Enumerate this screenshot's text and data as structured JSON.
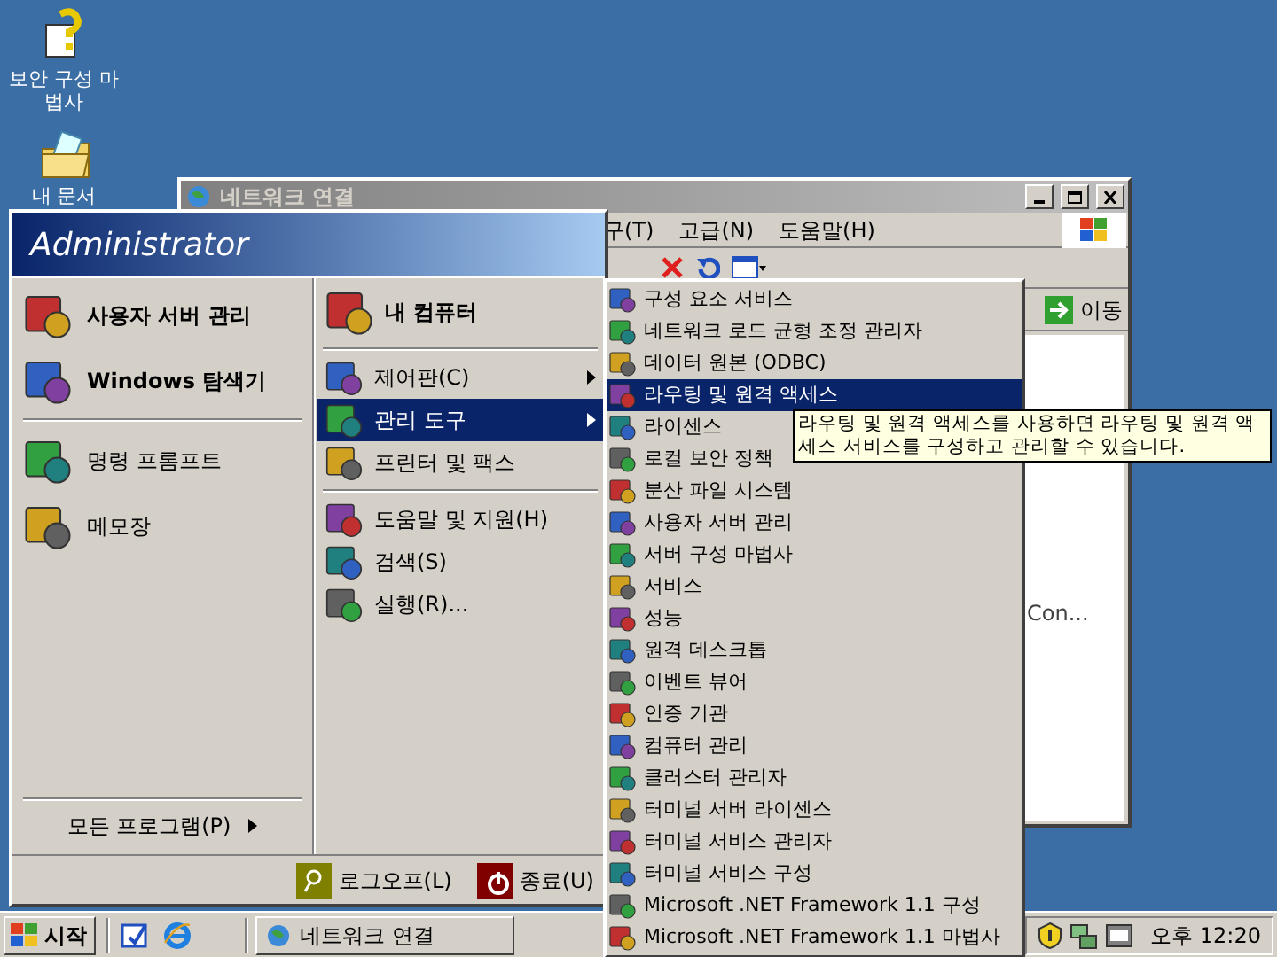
{
  "desktop_icons": [
    {
      "label": "보안 구성 마법사"
    },
    {
      "label": "내 문서"
    }
  ],
  "background_window": {
    "title": "네트워크 연결",
    "menu": [
      "구(T)",
      "고급(N)",
      "도움말(H)"
    ],
    "go_button": "이동",
    "content_text": "Con..."
  },
  "start_menu": {
    "user": "Administrator",
    "pinned": [
      {
        "label": "사용자 서버 관리"
      },
      {
        "label": "Windows 탐색기"
      }
    ],
    "recent": [
      {
        "label": "명령 프롬프트"
      },
      {
        "label": "메모장"
      }
    ],
    "all_programs": "모든 프로그램(P)",
    "right_groups": [
      [
        {
          "label": "내 컴퓨터",
          "bold": true,
          "arrow": false,
          "selected": false
        }
      ],
      [
        {
          "label": "제어판(C)",
          "bold": false,
          "arrow": true,
          "selected": false
        },
        {
          "label": "관리 도구",
          "bold": false,
          "arrow": true,
          "selected": true
        },
        {
          "label": "프린터 및 팩스",
          "bold": false,
          "arrow": false,
          "selected": false
        }
      ],
      [
        {
          "label": "도움말 및 지원(H)",
          "bold": false,
          "arrow": false,
          "selected": false
        },
        {
          "label": "검색(S)",
          "bold": false,
          "arrow": false,
          "selected": false
        },
        {
          "label": "실행(R)...",
          "bold": false,
          "arrow": false,
          "selected": false
        }
      ]
    ],
    "logoff": "로그오프(L)",
    "shutdown": "종료(U)"
  },
  "submenu": [
    {
      "label": "구성 요소 서비스",
      "selected": false
    },
    {
      "label": "네트워크 로드 균형 조정 관리자",
      "selected": false
    },
    {
      "label": "데이터 원본 (ODBC)",
      "selected": false
    },
    {
      "label": "라우팅 및 원격 액세스",
      "selected": true
    },
    {
      "label": "라이센스",
      "selected": false
    },
    {
      "label": "로컬 보안 정책",
      "selected": false
    },
    {
      "label": "분산 파일 시스템",
      "selected": false
    },
    {
      "label": "사용자 서버 관리",
      "selected": false
    },
    {
      "label": "서버 구성 마법사",
      "selected": false
    },
    {
      "label": "서비스",
      "selected": false
    },
    {
      "label": "성능",
      "selected": false
    },
    {
      "label": "원격 데스크톱",
      "selected": false
    },
    {
      "label": "이벤트 뷰어",
      "selected": false
    },
    {
      "label": "인증 기관",
      "selected": false
    },
    {
      "label": "컴퓨터 관리",
      "selected": false
    },
    {
      "label": "클러스터 관리자",
      "selected": false
    },
    {
      "label": "터미널 서버 라이센스",
      "selected": false
    },
    {
      "label": "터미널 서비스 관리자",
      "selected": false
    },
    {
      "label": "터미널 서비스 구성",
      "selected": false
    },
    {
      "label": "Microsoft .NET Framework 1.1 구성",
      "selected": false
    },
    {
      "label": "Microsoft .NET Framework 1.1 마법사",
      "selected": false
    }
  ],
  "tooltip": "라우팅 및 원격 액세스를 사용하면 라우팅 및 원격 액세스 서비스를 구성하고 관리할 수 있습니다.",
  "taskbar": {
    "start": "시작",
    "tasks": [
      {
        "label": "네트워크 연결",
        "selected": false
      }
    ],
    "clock": "오후 12:20"
  }
}
